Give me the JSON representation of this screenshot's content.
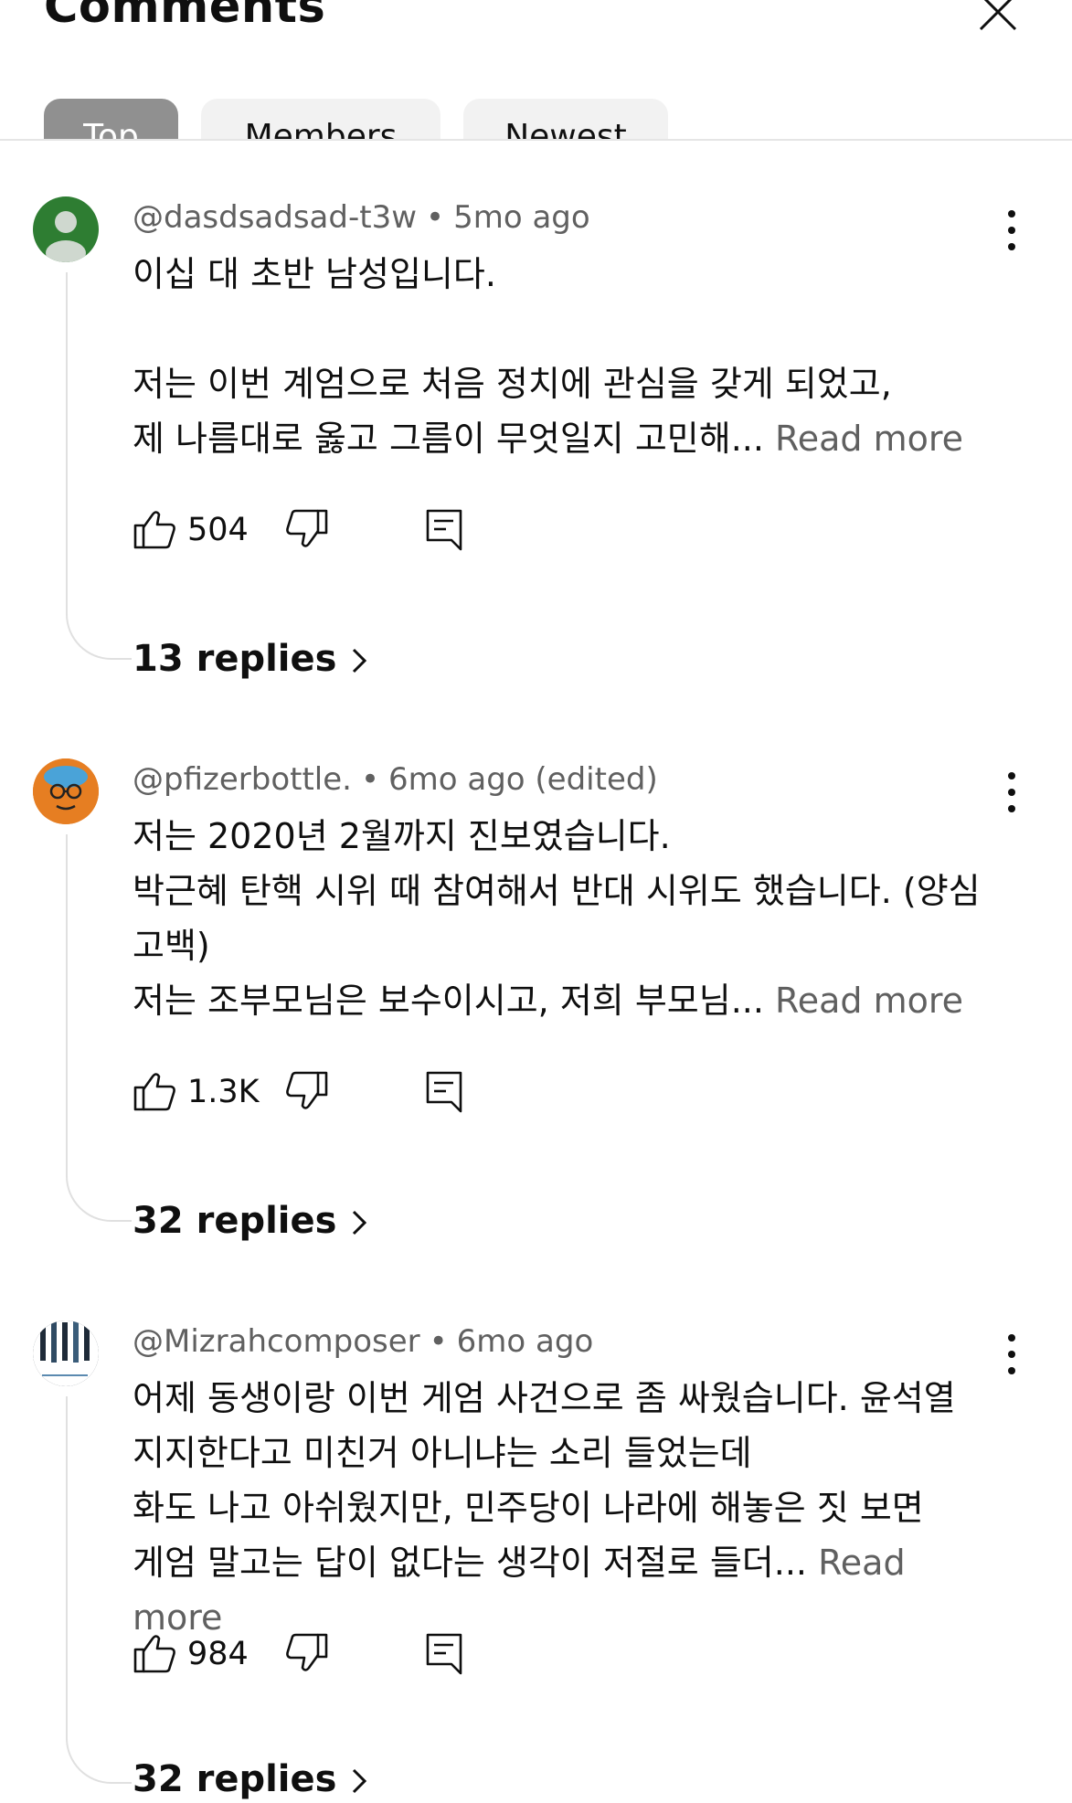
{
  "header": {
    "title": "Comments",
    "close_icon": "close-icon",
    "tabs": [
      {
        "label": "Top",
        "active": true
      },
      {
        "label": "Members",
        "active": false
      },
      {
        "label": "Newest",
        "active": false
      }
    ]
  },
  "comments": [
    {
      "author": "@dasdsadsad-t3w",
      "time": "5mo ago",
      "text": "이십 대 초반 남성입니다.\n\n저는 이번 계엄으로 처음 정치에 관심을 갖게 되었고,\n제 나름대로 옳고 그름이 무엇일지 고민해... ",
      "read_more": "Read more",
      "likes": "504",
      "replies": "13 replies",
      "avatar_color": "#2e7d32"
    },
    {
      "author": "@pfizerbottle.",
      "time": "6mo ago (edited)",
      "text": "저는 2020년 2월까지 진보였습니다.\n박근혜 탄핵 시위 때 참여해서 반대 시위도 했습니다. (양심 고백)\n저는 조부모님은 보수이시고, 저희 부모님... ",
      "read_more": "Read more",
      "likes": "1.3K",
      "replies": "32 replies",
      "avatar_color": "#e67e22"
    },
    {
      "author": "@Mizrahcomposer",
      "time": "6mo ago",
      "text": "어제 동생이랑 이번 게엄 사건으로 좀 싸웠습니다. 윤석열 지지한다고 미친거 아니냐는 소리 들었는데\n화도 나고 아쉬웠지만, 민주당이 나라에 해놓은 짓 보면 게엄 말고는 답이 없다는 생각이 저절로 들더... ",
      "read_more": "Read more",
      "likes": "984",
      "replies": "32 replies",
      "avatar_color": "#1e2a38"
    }
  ],
  "separator": "•"
}
